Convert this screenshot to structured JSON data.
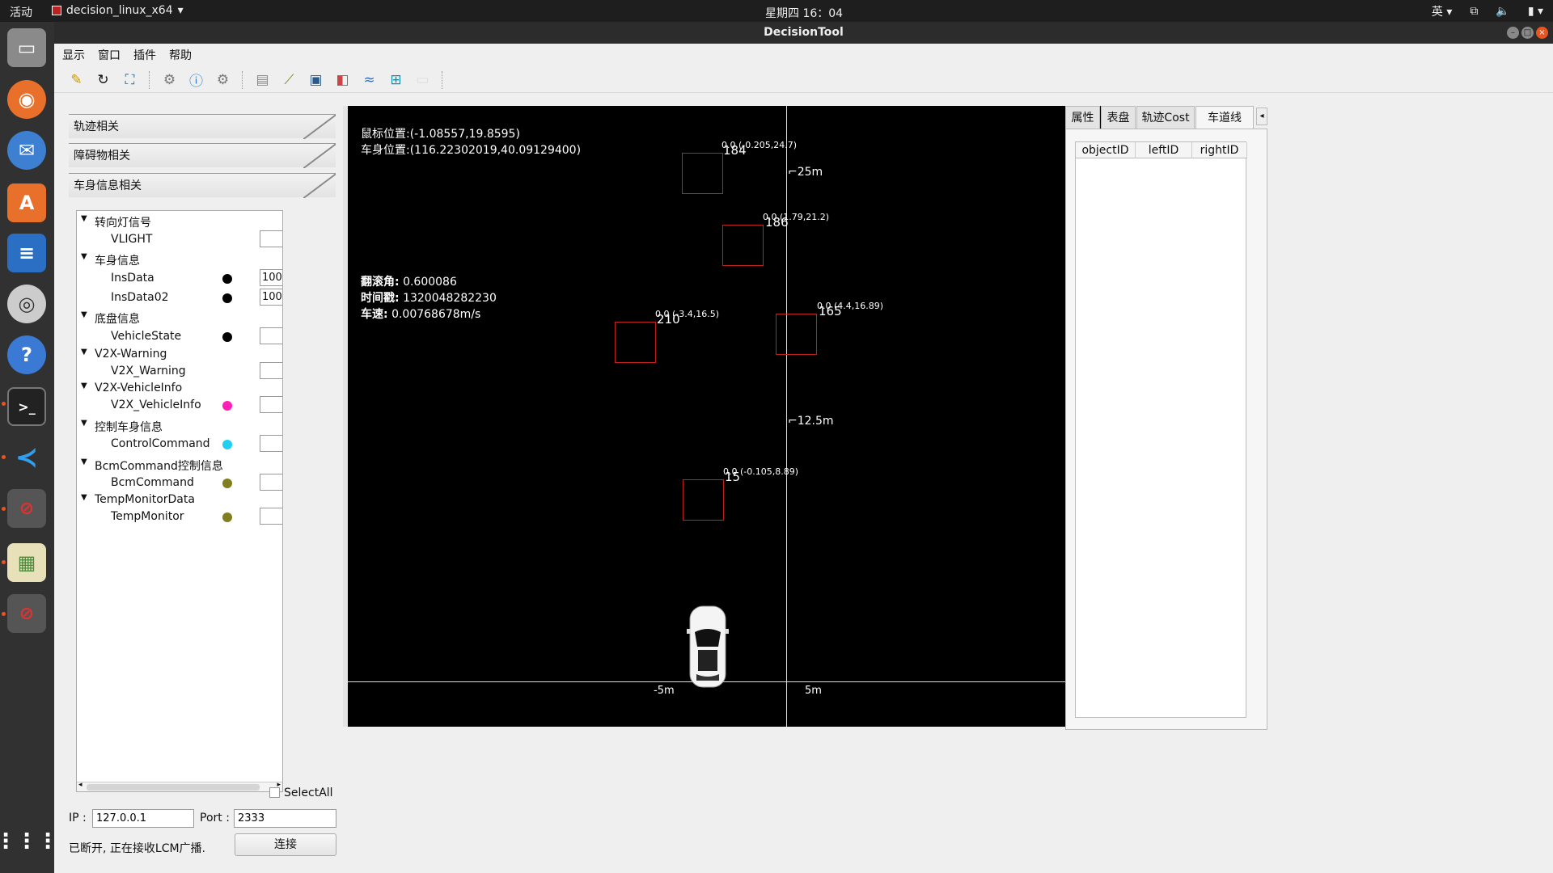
{
  "topbar": {
    "activities": "活动",
    "app": "decision_linux_x64",
    "clock": "星期四 16：04",
    "lang": "英"
  },
  "window": {
    "title": "DecisionTool"
  },
  "menu": [
    "显示",
    "窗口",
    "插件",
    "帮助"
  ],
  "accordion": [
    "轨迹相关",
    "障碍物相关",
    "车身信息相关"
  ],
  "tree": [
    {
      "label": "转向灯信号",
      "level": 0
    },
    {
      "label": "VLIGHT",
      "level": 1,
      "value": ""
    },
    {
      "label": "车身信息",
      "level": 0
    },
    {
      "label": "InsData",
      "level": 1,
      "dot": "#000000",
      "value": "100"
    },
    {
      "label": "InsData02",
      "level": 1,
      "dot": "#000000",
      "value": "100"
    },
    {
      "label": "底盘信息",
      "level": 0
    },
    {
      "label": "VehicleState",
      "level": 1,
      "dot": "#000000",
      "value": ""
    },
    {
      "label": "V2X-Warning",
      "level": 0
    },
    {
      "label": "V2X_Warning",
      "level": 1,
      "value": ""
    },
    {
      "label": "V2X-VehicleInfo",
      "level": 0
    },
    {
      "label": "V2X_VehicleInfo",
      "level": 1,
      "dot": "#ff1fb4",
      "value": ""
    },
    {
      "label": "控制车身信息",
      "level": 0
    },
    {
      "label": "ControlCommand",
      "level": 1,
      "dot": "#1fcfef",
      "value": ""
    },
    {
      "label": "BcmCommand控制信息",
      "level": 0
    },
    {
      "label": "BcmCommand",
      "level": 1,
      "dot": "#7f7f1f",
      "value": ""
    },
    {
      "label": "TempMonitorData",
      "level": 0
    },
    {
      "label": "TempMonitor",
      "level": 1,
      "dot": "#7f7f1f",
      "value": ""
    }
  ],
  "selectAll": "SelectAll",
  "conn": {
    "ipLabel": "IP :",
    "ip": "127.0.0.1",
    "portLabel": "Port :",
    "port": "2333",
    "status": "已断开, 正在接收LCM广播.",
    "button": "连接"
  },
  "canvas": {
    "mouse": "鼠标位置:(-1.08557,19.8595)",
    "car": "车身位置:(116.22302019,40.09129400)",
    "roll_label": "翻滚角:",
    "roll": "0.600086",
    "ts_label": "时间戳:",
    "ts": "1320048282230",
    "speed_label": "车速:",
    "speed": "0.00768678m/s",
    "dist": [
      "25m",
      "12.5m"
    ],
    "axis": [
      "-5m",
      "5m"
    ],
    "obstacles": [
      {
        "id": "184",
        "label": "0.0 (-0.205,24.7)"
      },
      {
        "id": "186",
        "label": "0.0 (1.79,21.2)"
      },
      {
        "id": "210",
        "label": "0.0 (-3.4,16.5)"
      },
      {
        "id": "165",
        "label": "0.0 (4.4,16.89)"
      },
      {
        "id": "15",
        "label": "0.0 (-0.105,8.89)"
      }
    ]
  },
  "rtabs": [
    "属性",
    "表盘",
    "轨迹Cost",
    "车道线"
  ],
  "rcols": [
    "objectID",
    "leftID",
    "rightID"
  ]
}
